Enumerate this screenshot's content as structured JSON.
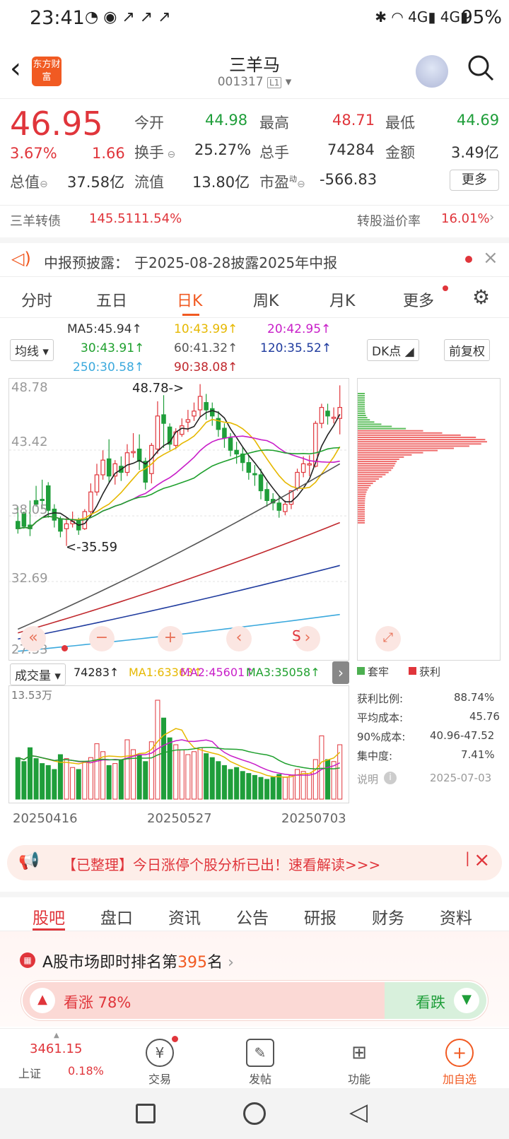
{
  "status_bar": {
    "time": "23:41",
    "battery": "95%",
    "network_1": "4G",
    "network_2": "4G"
  },
  "header": {
    "stock_name": "三羊马",
    "stock_code": "001317",
    "level_badge": "L1",
    "logo_text": "东方财富"
  },
  "quote": {
    "price": "46.95",
    "change_pct": "3.67%",
    "change_amt": "1.66",
    "open_label": "今开",
    "open": "44.98",
    "high_label": "最高",
    "high": "48.71",
    "low_label": "最低",
    "low": "44.69",
    "turnover_label": "换手",
    "turnover": "25.27%",
    "volume_label": "总手",
    "volume": "74284",
    "amount_label": "金额",
    "amount": "3.49亿",
    "mktcap_label": "总值",
    "mktcap": "37.58亿",
    "float_label": "流值",
    "float_cap": "13.80亿",
    "pe_label": "市盈",
    "pe_sup": "动",
    "pe": "-566.83",
    "more": "更多"
  },
  "convertible": {
    "name": "三羊转债",
    "price": "145.511",
    "pct": "1.54%",
    "premium_label": "转股溢价率",
    "premium": "16.01%"
  },
  "notice": {
    "label": "中报预披露：",
    "text": "于2025-08-28披露2025年中报"
  },
  "kline_tabs": [
    "分时",
    "五日",
    "日K",
    "周K",
    "月K",
    "更多"
  ],
  "active_kline_tab": "日K",
  "ma_legend": {
    "ma5": "MA5:45.94↑",
    "ma10": "10:43.99↑",
    "ma20": "20:42.95↑",
    "ma30": "30:43.91↑",
    "ma60": "60:41.32↑",
    "ma120": "120:35.52↑",
    "ma250": "250:30.58↑",
    "ma90": "90:38.08↑",
    "selector": "均线",
    "dk": "DK点",
    "adjust": "前复权"
  },
  "price_axis": {
    "top": "48.78",
    "mid1": "43.42",
    "mid2": "38.05",
    "mid3": "32.69",
    "bottom": "27.33"
  },
  "annotations": {
    "high_marker": "48.78->",
    "low_marker": "<-35.59",
    "s_marker": "S"
  },
  "volume": {
    "selector": "成交量",
    "value": "74283↑",
    "ma1": "MA1:63363↑",
    "ma2": "MA2:45601↑",
    "ma3": "MA3:35058↑",
    "axis_max": "13.53万"
  },
  "dates": [
    "20250416",
    "20250527",
    "20250703"
  ],
  "distribution": {
    "legend_trapped": "套牢",
    "legend_profit": "获利",
    "profit_ratio_label": "获利比例:",
    "profit_ratio": "88.74%",
    "avg_cost_label": "平均成本:",
    "avg_cost": "45.76",
    "cost90_label": "90%成本:",
    "cost90": "40.96-47.52",
    "concentration_label": "集中度:",
    "concentration": "7.41%",
    "note_label": "说明",
    "date": "2025-07-03"
  },
  "banner": {
    "text": "【已整理】今日涨停个股分析已出！速看解读>>>"
  },
  "bottom_tabs": [
    "股吧",
    "盘口",
    "资讯",
    "公告",
    "研报",
    "财务",
    "资料"
  ],
  "active_bottom_tab": "股吧",
  "rank": {
    "prefix": "A股市场即时排名第",
    "number": "395",
    "suffix": "名"
  },
  "vote": {
    "up_label": "看涨 78%",
    "down_label": "看跌",
    "up_ratio": 0.78
  },
  "nav": {
    "index_value": "3461.15",
    "index_name": "上证",
    "index_pct": "0.18%",
    "trade": "交易",
    "post": "发帖",
    "function": "功能",
    "watchlist": "加自选"
  },
  "colors": {
    "up": "#e0353b",
    "down": "#1f9e3a",
    "accent": "#f15a22"
  },
  "chart_data": {
    "type": "candlestick",
    "ylim": [
      27.33,
      48.78
    ],
    "candles": [
      [
        37.6,
        38.8,
        37.0,
        36.6
      ],
      [
        38.3,
        38.4,
        37.2,
        37.0
      ],
      [
        37.3,
        39.3,
        37.0,
        36.4
      ],
      [
        39.3,
        40.5,
        39.0,
        38.8
      ],
      [
        39.4,
        41.0,
        39.3,
        38.6
      ],
      [
        40.5,
        40.8,
        38.5,
        37.9
      ],
      [
        38.6,
        39.0,
        37.7,
        37.1
      ],
      [
        37.8,
        38.0,
        36.8,
        36.3
      ],
      [
        37.0,
        37.9,
        37.4,
        35.6
      ],
      [
        37.4,
        38.4,
        37.6,
        37.1
      ],
      [
        37.7,
        37.9,
        36.9,
        36.5
      ],
      [
        37.0,
        38.6,
        38.4,
        36.9
      ],
      [
        38.4,
        40.7,
        40.0,
        38.2
      ],
      [
        40.0,
        42.3,
        41.4,
        39.7
      ],
      [
        41.4,
        43.4,
        42.6,
        41.0
      ],
      [
        42.7,
        44.3,
        41.3,
        40.8
      ],
      [
        41.3,
        42.6,
        42.3,
        40.6
      ],
      [
        42.1,
        42.9,
        41.6,
        40.9
      ],
      [
        41.6,
        43.9,
        43.2,
        41.3
      ],
      [
        43.2,
        44.8,
        43.3,
        42.8
      ],
      [
        43.5,
        44.7,
        42.5,
        41.8
      ],
      [
        42.5,
        42.8,
        40.8,
        40.2
      ],
      [
        41.5,
        44.0,
        43.8,
        40.7
      ],
      [
        43.5,
        47.4,
        46.2,
        43.1
      ],
      [
        46.3,
        47.9,
        45.6,
        43.6
      ],
      [
        45.3,
        45.6,
        43.9,
        43.4
      ],
      [
        43.8,
        45.2,
        44.9,
        43.5
      ],
      [
        44.7,
        46.0,
        45.4,
        44.5
      ],
      [
        45.7,
        46.7,
        45.9,
        44.9
      ],
      [
        46.2,
        47.3,
        46.6,
        45.8
      ],
      [
        46.7,
        48.8,
        47.8,
        46.1
      ],
      [
        47.3,
        48.0,
        46.7,
        45.9
      ],
      [
        46.8,
        47.3,
        46.2,
        45.4
      ],
      [
        46.0,
        46.6,
        45.1,
        44.5
      ],
      [
        45.2,
        45.6,
        44.4,
        43.6
      ],
      [
        44.4,
        44.8,
        43.4,
        42.9
      ],
      [
        43.4,
        44.1,
        43.1,
        42.3
      ],
      [
        43.1,
        43.7,
        42.4,
        41.7
      ],
      [
        42.4,
        43.0,
        41.6,
        41.0
      ],
      [
        41.5,
        42.2,
        41.4,
        40.5
      ],
      [
        41.4,
        41.9,
        40.1,
        39.4
      ],
      [
        40.2,
        40.8,
        39.3,
        38.8
      ],
      [
        39.4,
        39.9,
        39.1,
        38.5
      ],
      [
        39.1,
        39.7,
        38.5,
        37.9
      ],
      [
        38.4,
        39.3,
        39.0,
        38.1
      ],
      [
        39.0,
        39.6,
        40.1,
        38.6
      ],
      [
        40.3,
        41.9,
        41.6,
        40.1
      ],
      [
        41.6,
        42.9,
        42.3,
        41.2
      ],
      [
        42.2,
        43.0,
        42.3,
        41.3
      ],
      [
        42.1,
        45.8,
        45.6,
        42.0
      ],
      [
        45.6,
        47.2,
        46.9,
        45.2
      ],
      [
        46.6,
        47.2,
        46.2,
        45.5
      ],
      [
        46.0,
        46.9,
        46.1,
        45.6
      ],
      [
        46.0,
        48.7,
        46.9,
        44.7
      ]
    ],
    "volumes": [
      0.42,
      0.38,
      0.52,
      0.41,
      0.36,
      0.34,
      0.3,
      0.45,
      0.41,
      0.32,
      0.3,
      0.38,
      0.42,
      0.56,
      0.48,
      0.34,
      0.36,
      0.4,
      0.6,
      0.5,
      0.45,
      0.38,
      0.58,
      1.0,
      0.82,
      0.62,
      0.55,
      0.5,
      0.45,
      0.48,
      0.52,
      0.46,
      0.42,
      0.38,
      0.34,
      0.3,
      0.32,
      0.28,
      0.26,
      0.24,
      0.22,
      0.2,
      0.22,
      0.25,
      0.22,
      0.24,
      0.3,
      0.28,
      0.26,
      0.4,
      0.64,
      0.4,
      0.38,
      0.55
    ]
  }
}
